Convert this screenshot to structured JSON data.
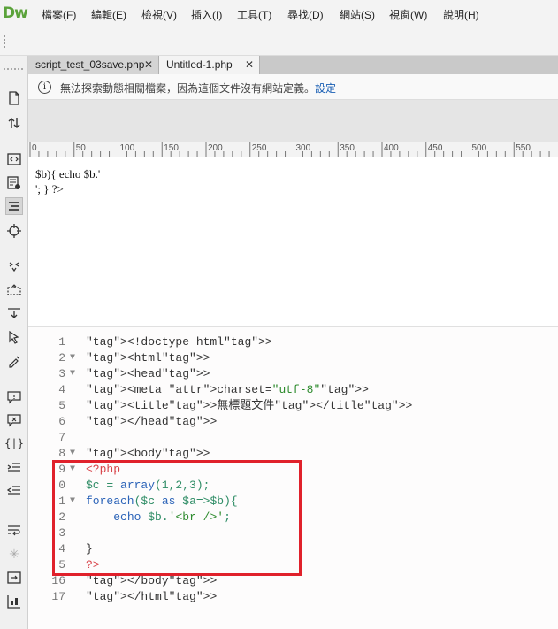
{
  "app": {
    "logo": "Dw"
  },
  "menu": [
    "檔案(F)",
    "編輯(E)",
    "檢視(V)",
    "插入(I)",
    "工具(T)",
    "尋找(D)",
    "網站(S)",
    "視窗(W)",
    "說明(H)"
  ],
  "tabs": [
    {
      "label": "script_test_03save.php",
      "close": "✕"
    },
    {
      "label": "Untitled-1.php",
      "close": "✕"
    }
  ],
  "infobar": {
    "message": "無法探索動態相關檔案，因為這個文件沒有網站定義。",
    "link": "設定"
  },
  "ruler": {
    "ticks": [
      "0",
      "50",
      "100",
      "150",
      "200",
      "250",
      "300",
      "350",
      "400",
      "450",
      "500",
      "550"
    ]
  },
  "design_view": {
    "lines": [
      "$b){ echo $b.'",
      "'; } ?>"
    ]
  },
  "code": {
    "line_numbers": [
      "1",
      "2",
      "3",
      "4",
      "5",
      "6",
      "7",
      "8",
      "9",
      "0",
      "1",
      "2",
      "3",
      "4",
      "5",
      "16",
      "17"
    ],
    "lines": [
      "<!doctype html>",
      "<html>",
      "<head>",
      "<meta charset=\"utf-8\">",
      "<title>無標題文件</title>",
      "</head>",
      "",
      "<body>",
      "<?php",
      "$c = array(1,2,3);",
      "foreach($c as $a=>$b){",
      "    echo $b.'<br />';",
      "",
      "}",
      "?>",
      "</body>",
      "</html>"
    ]
  },
  "colors": {
    "highlight_box": "#e0212b",
    "logo": "#5aa23a",
    "link": "#1a5fb4"
  }
}
